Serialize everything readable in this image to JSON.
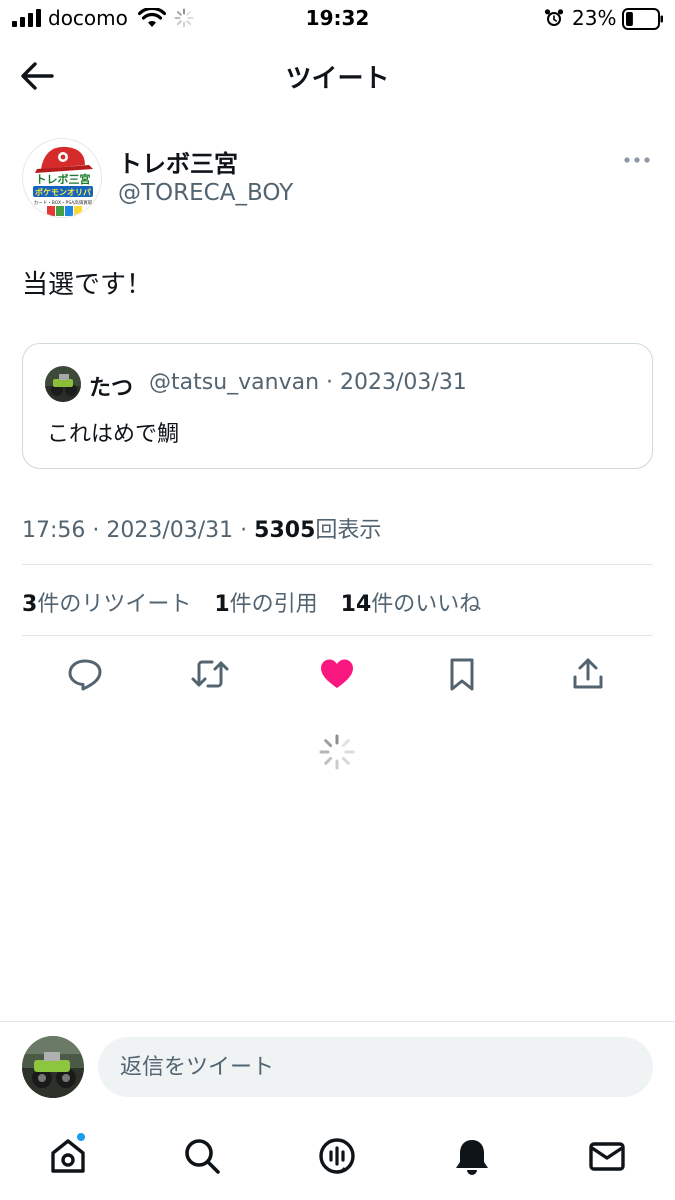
{
  "status_bar": {
    "carrier": "docomo",
    "time": "19:32",
    "battery_percent": "23%",
    "battery_level": 0.23,
    "icons": [
      "signal-icon",
      "wifi-icon",
      "activity-spinner-icon",
      "alarm-icon",
      "battery-icon"
    ]
  },
  "header": {
    "title": "ツイート",
    "back_icon": "back-arrow-icon"
  },
  "tweet": {
    "author_name": "トレボ三宮",
    "author_handle": "@TORECA_BOY",
    "avatar_text_line1": "トレボ三宮",
    "avatar_text_line2": "ポケモンオリパ",
    "avatar_text_line3": "カード・BOX・PSA高価買取",
    "text": "当選です！",
    "quote": {
      "name": "たつ",
      "handle_date": "@tatsu_vanvan · 2023/03/31",
      "text": "これはめで鯛"
    },
    "time_date": "17:56 · 2023/03/31 · ",
    "views_count": "5305",
    "views_label": "回表示",
    "stats": [
      {
        "count": "3",
        "label": "件のリツイート"
      },
      {
        "count": "1",
        "label": "件の引用"
      },
      {
        "count": "14",
        "label": "件のいいね"
      }
    ],
    "liked": true
  },
  "actions": [
    "reply-icon",
    "retweet-icon",
    "heart-icon",
    "bookmark-icon",
    "share-icon"
  ],
  "reply_bar": {
    "placeholder": "返信をツイート"
  },
  "tabbar": {
    "items": [
      "home-icon",
      "search-icon",
      "spaces-icon",
      "notifications-icon",
      "messages-icon"
    ],
    "home_has_dot": true
  },
  "colors": {
    "accent": "#1d9bf0",
    "like": "#f91880",
    "secondary_text": "#536471",
    "border": "#cfd9de"
  }
}
